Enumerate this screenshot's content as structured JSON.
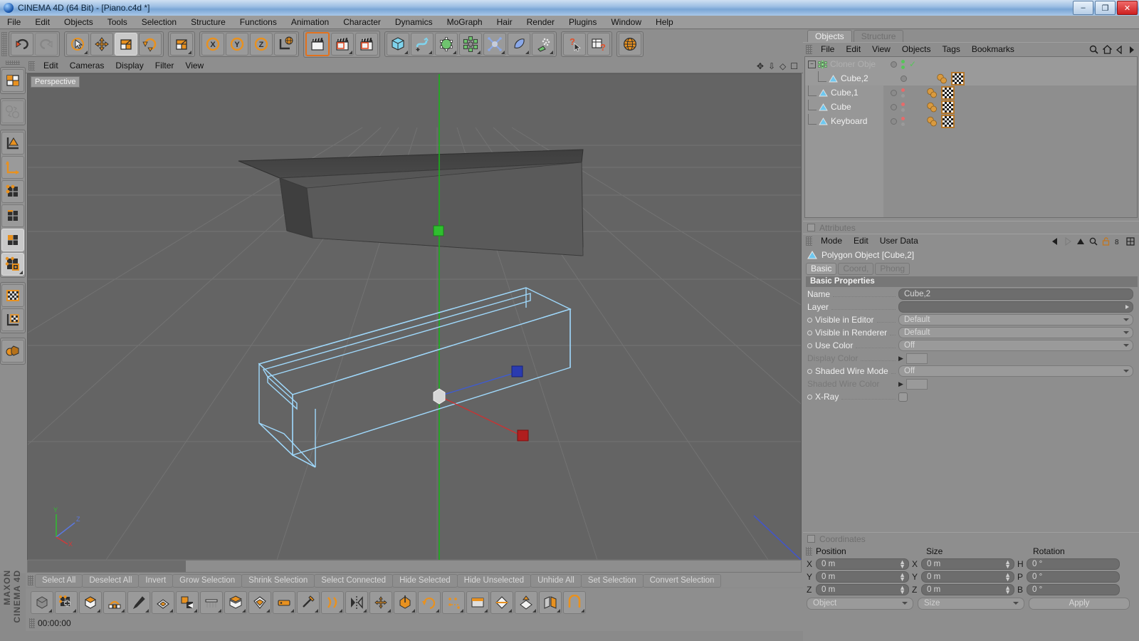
{
  "window": {
    "title": "CINEMA 4D (64 Bit) - [Piano.c4d *]",
    "app_icon": "c4d-sphere-icon",
    "buttons": {
      "minimize": "–",
      "maximize": "❐",
      "close": "✕"
    }
  },
  "menubar": {
    "items": [
      "File",
      "Edit",
      "Objects",
      "Tools",
      "Selection",
      "Structure",
      "Functions",
      "Animation",
      "Character",
      "Dynamics",
      "MoGraph",
      "Hair",
      "Render",
      "Plugins",
      "Window",
      "Help"
    ]
  },
  "toolbar": {
    "groups": [
      {
        "name": "undo-redo",
        "buttons": [
          {
            "icon": "undo-icon",
            "state": "normal",
            "label": "Undo"
          },
          {
            "icon": "redo-icon",
            "state": "disabled",
            "label": "Redo"
          }
        ]
      },
      {
        "name": "transform-tools",
        "buttons": [
          {
            "icon": "select-live-icon",
            "state": "menu",
            "label": "Live Selection"
          },
          {
            "icon": "move-icon",
            "state": "normal",
            "label": "Move"
          },
          {
            "icon": "scale-icon",
            "state": "active",
            "label": "Scale"
          },
          {
            "icon": "rotate-icon",
            "state": "normal",
            "label": "Rotate"
          }
        ]
      },
      {
        "name": "scale-modes",
        "buttons": [
          {
            "icon": "scale-alt-icon",
            "state": "menu",
            "label": "Scale Mode"
          }
        ]
      },
      {
        "name": "axis-locks",
        "buttons": [
          {
            "icon": "axis-x-icon",
            "state": "normal",
            "label": "X Axis"
          },
          {
            "icon": "axis-y-icon",
            "state": "normal",
            "label": "Y Axis"
          },
          {
            "icon": "axis-z-icon",
            "state": "normal",
            "label": "Z Axis"
          },
          {
            "icon": "world-axis-icon",
            "state": "normal",
            "label": "World/Object Axis"
          }
        ]
      },
      {
        "name": "render-tools",
        "buttons": [
          {
            "icon": "render-view-icon",
            "state": "hot",
            "label": "Render View"
          },
          {
            "icon": "render-region-icon",
            "state": "menu",
            "label": "Render Region"
          },
          {
            "icon": "render-settings-icon",
            "state": "normal",
            "label": "Render Settings"
          }
        ]
      },
      {
        "name": "primitives",
        "buttons": [
          {
            "icon": "cube-primitive-icon",
            "state": "menu",
            "label": "Cube"
          },
          {
            "icon": "spline-icon",
            "state": "menu",
            "label": "Spline"
          },
          {
            "icon": "nurbs-icon",
            "state": "menu",
            "label": "NURBS"
          },
          {
            "icon": "array-icon",
            "state": "menu",
            "label": "Modeling Object"
          },
          {
            "icon": "deformer-icon",
            "state": "menu",
            "label": "Deformer"
          },
          {
            "icon": "scene-icon",
            "state": "menu",
            "label": "Scene"
          },
          {
            "icon": "particles-icon",
            "state": "menu",
            "label": "Particles"
          }
        ]
      },
      {
        "name": "help-tools",
        "buttons": [
          {
            "icon": "help-cursor-icon",
            "state": "normal",
            "label": "Context Help"
          },
          {
            "icon": "help-table-icon",
            "state": "normal",
            "label": "Help Table"
          }
        ]
      },
      {
        "name": "web",
        "buttons": [
          {
            "icon": "globe-icon",
            "state": "normal",
            "label": "Online"
          }
        ]
      }
    ]
  },
  "left_toolbar": {
    "groups": [
      [
        {
          "icon": "texture-axis-icon",
          "state": "normal",
          "label": "Texture Mode"
        }
      ],
      [
        {
          "icon": "object-axis-icon",
          "state": "disabled",
          "label": "Object/World"
        }
      ],
      [
        {
          "icon": "model-mode-icon",
          "state": "normal",
          "label": "Model Mode"
        },
        {
          "icon": "object-mode-icon",
          "state": "normal",
          "label": "Object Mode"
        },
        {
          "icon": "point-mode-icon",
          "state": "normal",
          "label": "Points"
        },
        {
          "icon": "edge-mode-icon",
          "state": "normal",
          "label": "Edges"
        },
        {
          "icon": "polygon-mode-icon",
          "state": "active",
          "label": "Polygons"
        },
        {
          "icon": "uv-points-icon",
          "state": "active",
          "label": "UV Points"
        }
      ],
      [
        {
          "icon": "texture-mode-icon",
          "state": "normal",
          "label": "Texture"
        },
        {
          "icon": "texture-axis2-icon",
          "state": "normal",
          "label": "Texture Axis"
        }
      ],
      [
        {
          "icon": "enable-axis-icon",
          "state": "normal",
          "label": "Enable Axis"
        }
      ]
    ],
    "brand_line1": "MAXON",
    "brand_line2": "CINEMA 4D"
  },
  "viewport": {
    "menu": [
      "Edit",
      "Cameras",
      "Display",
      "Filter",
      "View"
    ],
    "label": "Perspective",
    "axis_labels": {
      "x": "X",
      "y": "Y",
      "z": "Z"
    },
    "header_icons": [
      "pan-icon",
      "zoom-icon",
      "dolly-icon",
      "maximize-view-icon"
    ]
  },
  "selection_strip": {
    "buttons": [
      "Select All",
      "Deselect All",
      "Invert",
      "Grow Selection",
      "Shrink Selection",
      "Select Connected",
      "Hide Selected",
      "Hide Unselected",
      "Unhide All",
      "Set Selection",
      "Convert Selection"
    ]
  },
  "bottom_toolbar": {
    "buttons": [
      {
        "icon": "make-editable-icon",
        "label": "Make Editable"
      },
      {
        "icon": "add-point-icon",
        "label": "Add Point"
      },
      {
        "icon": "bevel-icon",
        "label": "Bevel"
      },
      {
        "icon": "bridge-icon",
        "label": "Bridge"
      },
      {
        "icon": "brush-icon",
        "label": "Brush"
      },
      {
        "icon": "close-hole-icon",
        "label": "Close Polygon Hole"
      },
      {
        "icon": "create-polygon-icon",
        "label": "Create Polygon"
      },
      {
        "icon": "iron-icon",
        "label": "Iron"
      },
      {
        "icon": "extrude-icon",
        "label": "Extrude"
      },
      {
        "icon": "extrude-inner-icon",
        "label": "Extrude Inner"
      },
      {
        "icon": "knife-icon",
        "label": "Knife"
      },
      {
        "icon": "magnet-icon",
        "label": "Magnet"
      },
      {
        "icon": "matrix-extrude-icon",
        "label": "Matrix Extrude"
      },
      {
        "icon": "mirror-icon",
        "label": "Mirror"
      },
      {
        "icon": "move-tool-icon",
        "label": "Move Tool"
      },
      {
        "icon": "normal-move-icon",
        "label": "Normal Move"
      },
      {
        "icon": "normal-rotate-icon",
        "label": "Normal Rotate"
      },
      {
        "icon": "normal-scale-icon",
        "label": "Normal Scale"
      },
      {
        "icon": "set-point-icon",
        "label": "Set Point Value"
      },
      {
        "icon": "slide-icon",
        "label": "Slide"
      },
      {
        "icon": "smooth-shift-icon",
        "label": "Smooth Shift"
      },
      {
        "icon": "split-icon",
        "label": "Split"
      },
      {
        "icon": "stitch-sew-icon",
        "label": "Stitch and Sew"
      }
    ]
  },
  "timecode": {
    "value": "00:00:00"
  },
  "object_manager": {
    "tabs": [
      {
        "label": "Objects",
        "active": true
      },
      {
        "label": "Structure",
        "active": false
      }
    ],
    "menu": [
      "File",
      "Edit",
      "View",
      "Objects",
      "Tags",
      "Bookmarks"
    ],
    "menu_icons": [
      "search-icon",
      "home-icon",
      "back-icon",
      "forward-icon"
    ],
    "rows": [
      {
        "name": "Cloner Obje",
        "indent": 0,
        "icon": "cloner-icon",
        "dimmed": true,
        "expander": "minus",
        "dot_left": "#8b8b8b",
        "dot_top": "#57c45a",
        "dot_bottom": "#57c45a",
        "check": true,
        "tags": []
      },
      {
        "name": "Cube,2",
        "indent": 1,
        "icon": "polygon-object-icon",
        "dimmed": false,
        "expander": "none",
        "dot_left": "#8b8b8b",
        "dot_top": "#9a9a9a",
        "dot_bottom": "#9a9a9a",
        "check": false,
        "tags": [
          "material-tag",
          "texture-tag"
        ]
      },
      {
        "name": "Cube,1",
        "indent": 0,
        "icon": "polygon-object-icon",
        "dimmed": false,
        "expander": "none",
        "dot_left": "#8b8b8b",
        "dot_top": "#e86a6a",
        "dot_bottom": "#9a9a9a",
        "check": false,
        "tags": [
          "material-tag",
          "texture-tag"
        ]
      },
      {
        "name": "Cube",
        "indent": 0,
        "icon": "polygon-object-icon",
        "dimmed": false,
        "expander": "none",
        "dot_left": "#8b8b8b",
        "dot_top": "#e86a6a",
        "dot_bottom": "#9a9a9a",
        "check": false,
        "tags": [
          "material-tag",
          "texture-tag"
        ]
      },
      {
        "name": "Keyboard",
        "indent": 0,
        "icon": "polygon-object-icon",
        "dimmed": false,
        "expander": "none",
        "dot_left": "#8b8b8b",
        "dot_top": "#e86a6a",
        "dot_bottom": "#9a9a9a",
        "check": false,
        "tags": [
          "material-tag",
          "texture-tag"
        ]
      }
    ]
  },
  "attributes": {
    "panel_title": "Attributes",
    "menu": [
      "Mode",
      "Edit",
      "User Data"
    ],
    "nav_icons": [
      "prev-icon",
      "next-icon",
      "up-icon",
      "search-icon",
      "lock-icon",
      "pin-icon",
      "grid-icon"
    ],
    "object_header": "Polygon Object [Cube,2]",
    "tabs": [
      {
        "label": "Basic",
        "active": true
      },
      {
        "label": "Coord,",
        "active": false
      },
      {
        "label": "Phong",
        "active": false
      }
    ],
    "section_title": "Basic Properties",
    "properties": [
      {
        "label": "Name",
        "type": "text",
        "value": "Cube,2",
        "bullet": false,
        "dim": false,
        "dots": true
      },
      {
        "label": "Layer",
        "type": "layer",
        "value": "",
        "bullet": false,
        "dim": false,
        "dots": true
      },
      {
        "label": "Visible in Editor",
        "type": "dropdown",
        "value": "Default",
        "bullet": true,
        "dim": false,
        "dots": true
      },
      {
        "label": "Visible in Renderer",
        "type": "dropdown",
        "value": "Default",
        "bullet": true,
        "dim": false,
        "dots": true
      },
      {
        "label": "Use Color",
        "type": "dropdown",
        "value": "Off",
        "bullet": true,
        "dim": false,
        "dots": true
      },
      {
        "label": "Display Color",
        "type": "swatch",
        "value": "",
        "bullet": false,
        "dim": true,
        "dots": true,
        "arrow": true
      },
      {
        "label": "Shaded Wire Mode",
        "type": "dropdown",
        "value": "Off",
        "bullet": true,
        "dim": false,
        "dots": true
      },
      {
        "label": "Shaded Wire Color",
        "type": "swatch",
        "value": "",
        "bullet": false,
        "dim": true,
        "dots": false,
        "arrow": true
      },
      {
        "label": "X-Ray",
        "type": "checkbox",
        "value": "",
        "bullet": true,
        "dim": false,
        "dots": true
      }
    ]
  },
  "coordinates": {
    "panel_title": "Coordinates",
    "columns": [
      "Position",
      "Size",
      "Rotation"
    ],
    "rows": [
      {
        "pos_axis": "X",
        "pos_value": "0 m",
        "size_axis": "X",
        "size_value": "0 m",
        "rot_axis": "H",
        "rot_value": "0 °"
      },
      {
        "pos_axis": "Y",
        "pos_value": "0 m",
        "size_axis": "Y",
        "size_value": "0 m",
        "rot_axis": "P",
        "rot_value": "0 °"
      },
      {
        "pos_axis": "Z",
        "pos_value": "0 m",
        "size_axis": "Z",
        "size_value": "0 m",
        "rot_axis": "B",
        "rot_value": "0 °"
      }
    ],
    "mode_dropdown": "Object",
    "size_dropdown": "Size",
    "apply_label": "Apply"
  }
}
